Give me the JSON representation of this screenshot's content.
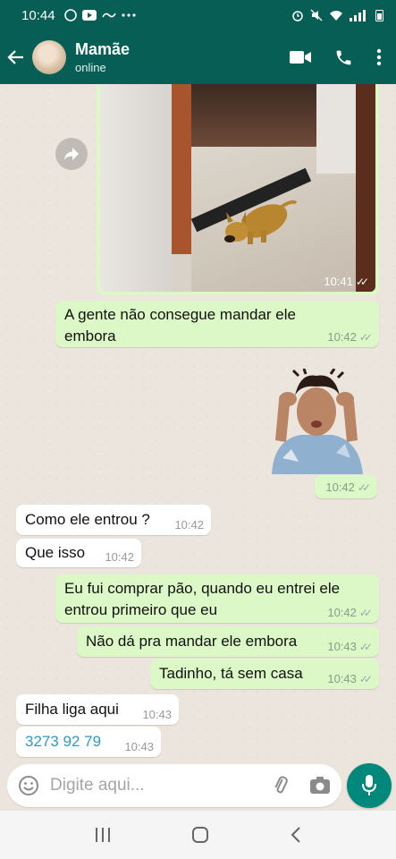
{
  "status_bar": {
    "time": "10:44"
  },
  "header": {
    "contact_name": "Mamãe",
    "contact_status": "online"
  },
  "messages": {
    "image": {
      "time": "10:41"
    },
    "m1": {
      "line1": "A gente não consegue mandar ele",
      "line2": "embora",
      "time": "10:42"
    },
    "sticker": {
      "time": "10:42"
    },
    "m2": {
      "text": "Como ele entrou ?",
      "time": "10:42"
    },
    "m3": {
      "text": "Que isso",
      "time": "10:42"
    },
    "m4": {
      "line1": "Eu fui comprar pão, quando eu entrei ele",
      "line2": "entrou primeiro que eu",
      "time": "10:42"
    },
    "m5": {
      "text": "Não dá pra mandar ele embora",
      "time": "10:43"
    },
    "m6": {
      "text": "Tadinho, tá sem casa",
      "time": "10:43"
    },
    "m7": {
      "text": "Filha liga aqui",
      "time": "10:43"
    },
    "m8": {
      "text": "3273 92 79",
      "time": "10:43"
    }
  },
  "input": {
    "placeholder": "Digite aqui..."
  },
  "colors": {
    "header": "#075e54",
    "outgoing": "#dcf8c6",
    "incoming": "#ffffff",
    "accent": "#00897b",
    "link": "#2a9bc1"
  },
  "icons": [
    "back-arrow-icon",
    "video-call-icon",
    "phone-icon",
    "more-icon",
    "forward-icon",
    "emoji-icon",
    "attach-icon",
    "camera-icon",
    "mic-icon",
    "recent-apps-icon",
    "home-icon",
    "nav-back-icon"
  ]
}
